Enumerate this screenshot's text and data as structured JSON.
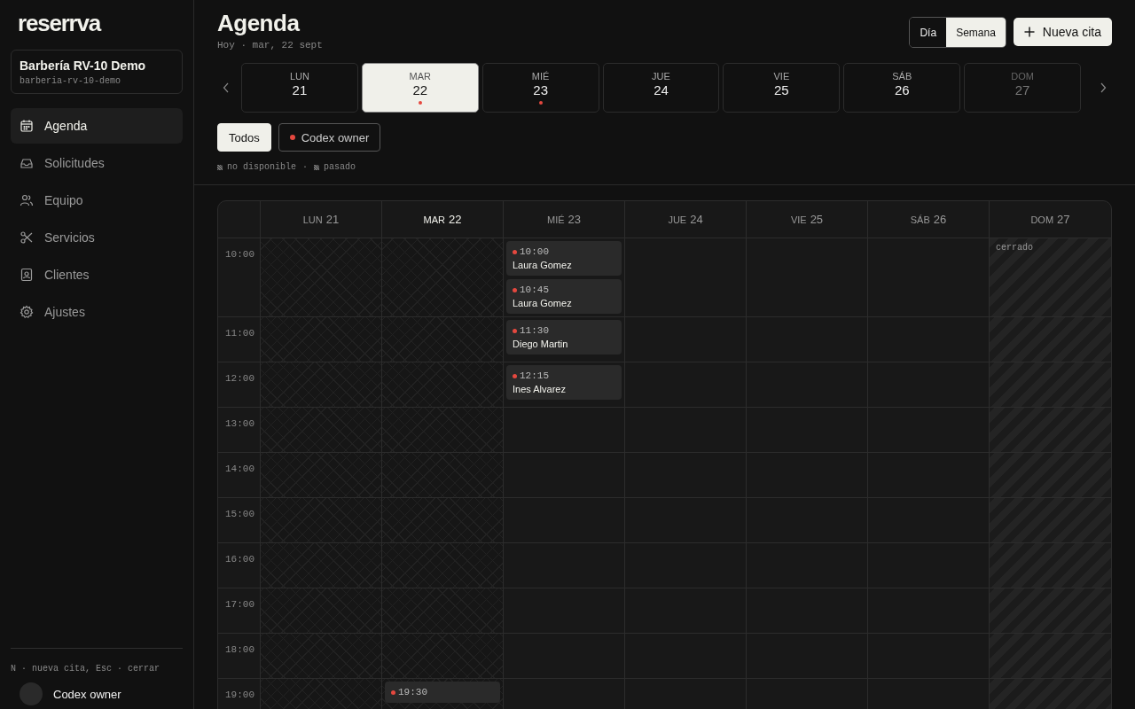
{
  "sidebar": {
    "logo": "reserrva",
    "business": {
      "name": "Barbería RV-10 Demo",
      "slug": "barberia-rv-10-demo"
    },
    "nav": [
      {
        "label": "Agenda",
        "selected": true
      },
      {
        "label": "Solicitudes",
        "selected": false
      },
      {
        "label": "Equipo",
        "selected": false
      },
      {
        "label": "Servicios",
        "selected": false
      },
      {
        "label": "Clientes",
        "selected": false
      },
      {
        "label": "Ajustes",
        "selected": false
      }
    ],
    "shortcut_hint": "N · nueva cita, Esc · cerrar",
    "user": {
      "name": "Codex owner"
    }
  },
  "header": {
    "title": "Agenda",
    "subtitle": "Hoy · mar, 22 sept",
    "views": [
      {
        "label": "Día",
        "selected": false
      },
      {
        "label": "Semana",
        "selected": true
      }
    ],
    "new_button": "Nueva cita"
  },
  "day_strip": [
    {
      "weekday": "LUN",
      "day": "21",
      "selected": false,
      "has_appointments": false,
      "closed": false
    },
    {
      "weekday": "MAR",
      "day": "22",
      "selected": true,
      "has_appointments": true,
      "closed": false
    },
    {
      "weekday": "MIÉ",
      "day": "23",
      "selected": false,
      "has_appointments": true,
      "closed": false
    },
    {
      "weekday": "JUE",
      "day": "24",
      "selected": false,
      "has_appointments": false,
      "closed": false
    },
    {
      "weekday": "VIE",
      "day": "25",
      "selected": false,
      "has_appointments": false,
      "closed": false
    },
    {
      "weekday": "SÁB",
      "day": "26",
      "selected": false,
      "has_appointments": false,
      "closed": false
    },
    {
      "weekday": "DOM",
      "day": "27",
      "selected": false,
      "has_appointments": false,
      "closed": true
    }
  ],
  "filters": [
    {
      "label": "Todos",
      "selected": true
    },
    {
      "label": "Codex owner",
      "selected": false,
      "color": "#e5483f"
    }
  ],
  "legend": {
    "items": [
      {
        "label": "no disponible"
      },
      {
        "label": "pasado"
      }
    ],
    "separator": "·"
  },
  "calendar": {
    "columns": [
      {
        "weekday": "LUN",
        "day": "21",
        "today": false,
        "kind": "past"
      },
      {
        "weekday": "MAR",
        "day": "22",
        "today": true,
        "kind": "past"
      },
      {
        "weekday": "MIÉ",
        "day": "23",
        "today": false,
        "kind": "open"
      },
      {
        "weekday": "JUE",
        "day": "24",
        "today": false,
        "kind": "open"
      },
      {
        "weekday": "VIE",
        "day": "25",
        "today": false,
        "kind": "open"
      },
      {
        "weekday": "SÁB",
        "day": "26",
        "today": false,
        "kind": "open"
      },
      {
        "weekday": "DOM",
        "day": "27",
        "today": false,
        "kind": "closed",
        "note": "cerrado"
      }
    ],
    "rows": [
      {
        "time": "10:00",
        "cells": [
          {},
          {},
          {
            "appointments": [
              {
                "time": "10:00",
                "client": "Laura Gomez",
                "color": "#e5483f"
              },
              {
                "time": "10:45",
                "client": "Laura Gomez",
                "color": "#e5483f"
              }
            ]
          },
          {},
          {},
          {},
          {}
        ]
      },
      {
        "time": "11:00",
        "cells": [
          {},
          {},
          {
            "appointments": [
              {
                "time": "11:30",
                "client": "Diego Martin",
                "color": "#e5483f"
              }
            ]
          },
          {},
          {},
          {},
          {}
        ]
      },
      {
        "time": "12:00",
        "cells": [
          {},
          {},
          {
            "appointments": [
              {
                "time": "12:15",
                "client": "Ines Alvarez",
                "color": "#e5483f"
              }
            ]
          },
          {},
          {},
          {},
          {}
        ]
      },
      {
        "time": "13:00"
      },
      {
        "time": "14:00"
      },
      {
        "time": "15:00"
      },
      {
        "time": "16:00"
      },
      {
        "time": "17:00"
      },
      {
        "time": "18:00"
      },
      {
        "time": "19:00",
        "cells": [
          {},
          {
            "appointments": [
              {
                "time": "19:30",
                "color": "#e5483f"
              }
            ]
          },
          {},
          {},
          {},
          {},
          {}
        ]
      }
    ]
  }
}
